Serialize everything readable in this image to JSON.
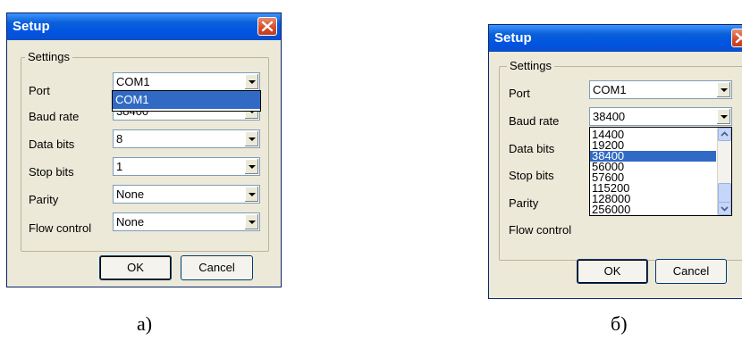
{
  "dialogs": [
    {
      "title": "Setup",
      "group_label": "Settings",
      "fields": [
        {
          "label": "Port",
          "value": "COM1"
        },
        {
          "label": "Baud rate",
          "value": "38400"
        },
        {
          "label": "Data bits",
          "value": "8"
        },
        {
          "label": "Stop bits",
          "value": "1"
        },
        {
          "label": "Parity",
          "value": "None"
        },
        {
          "label": "Flow control",
          "value": "None"
        }
      ],
      "dropdown_items": [
        "COM1"
      ],
      "ok_label": "OK",
      "cancel_label": "Cancel",
      "caption": "а)"
    },
    {
      "title": "Setup",
      "group_label": "Settings",
      "fields": [
        {
          "label": "Port",
          "value": "COM1"
        },
        {
          "label": "Baud rate",
          "value": "38400"
        },
        {
          "label": "Data bits",
          "value": ""
        },
        {
          "label": "Stop bits",
          "value": ""
        },
        {
          "label": "Parity",
          "value": ""
        },
        {
          "label": "Flow control",
          "value": ""
        }
      ],
      "dropdown_items": [
        "14400",
        "19200",
        "38400",
        "56000",
        "57600",
        "115200",
        "128000",
        "256000"
      ],
      "dropdown_selected": "38400",
      "ok_label": "OK",
      "cancel_label": "Cancel",
      "caption": "б)"
    }
  ],
  "colors": {
    "titlebar": "#0054e3",
    "dialog_bg": "#ece9d8",
    "selection": "#316ac5",
    "close_button": "#d54b2b"
  },
  "icons": {
    "close": "close-icon",
    "dropdown_arrow": "chevron-down-icon",
    "scroll_up": "scroll-up-icon",
    "scroll_down": "scroll-down-icon"
  }
}
